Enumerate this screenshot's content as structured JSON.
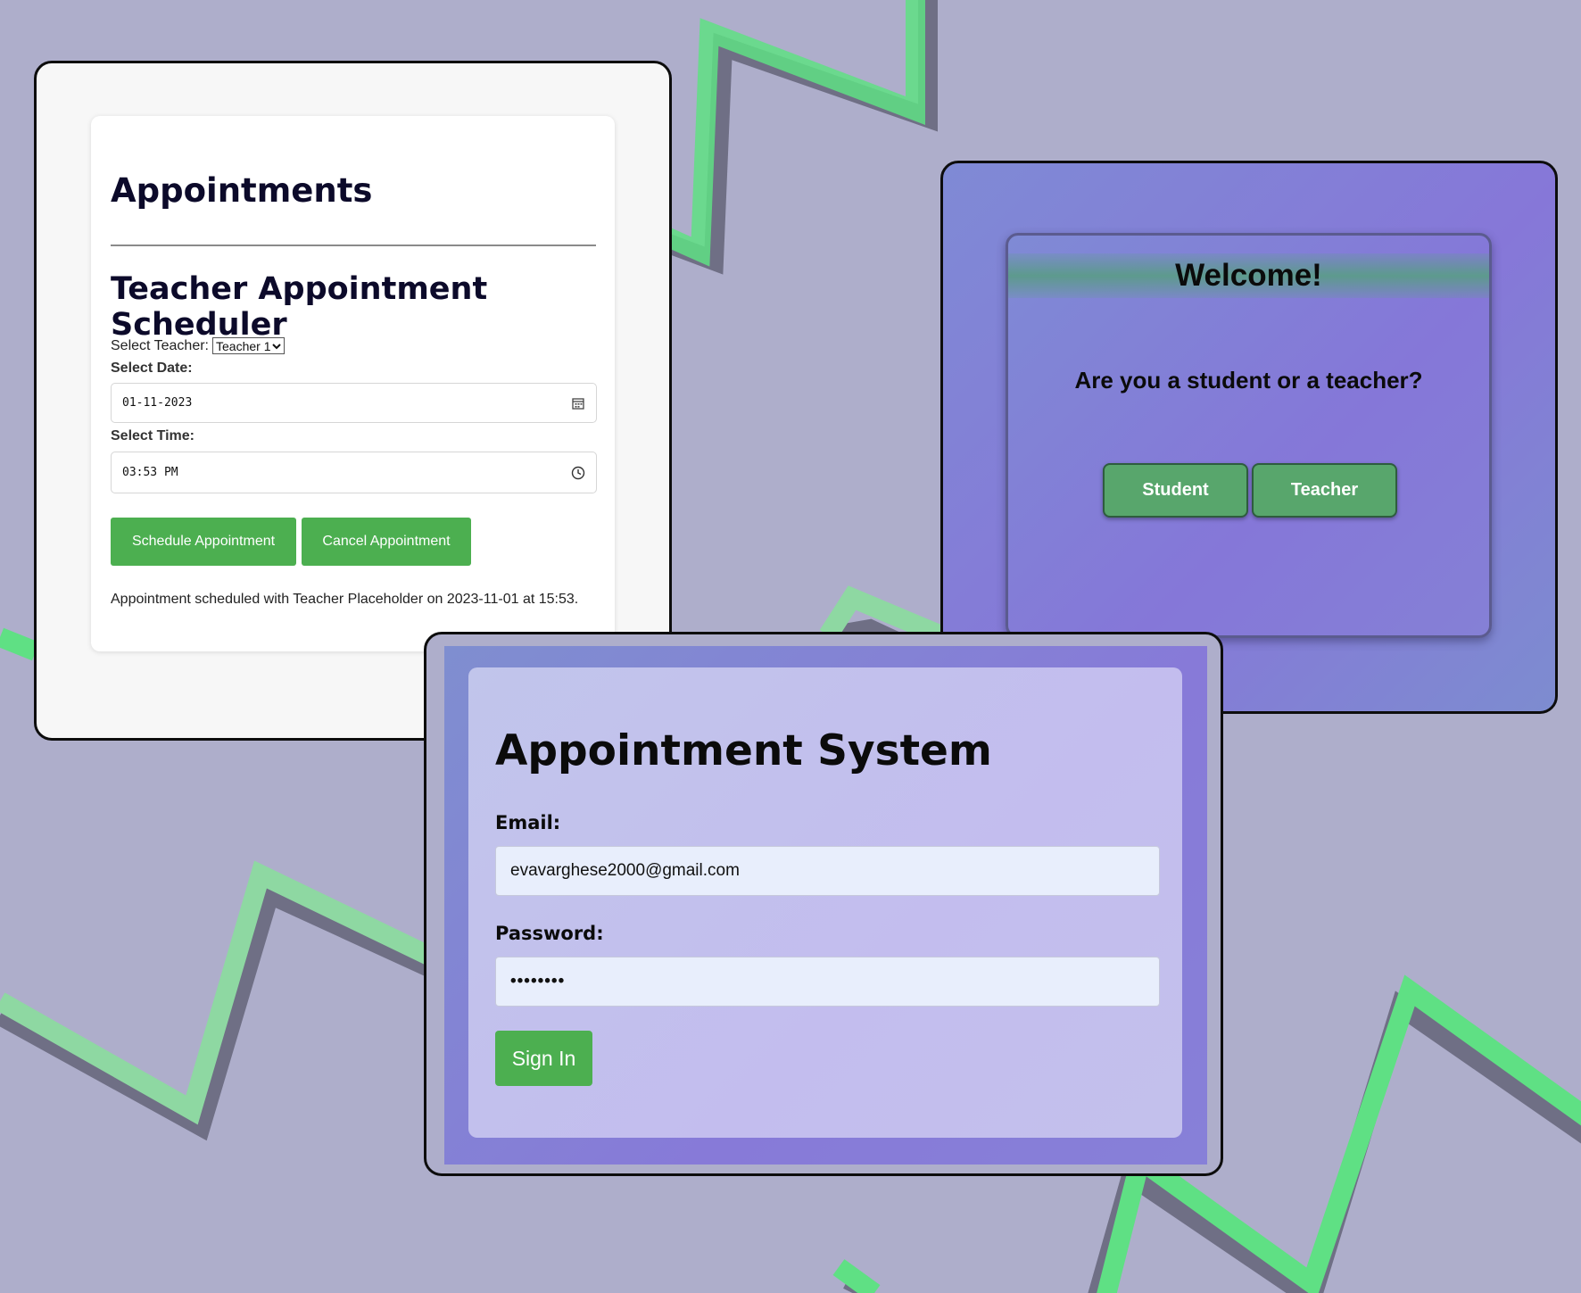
{
  "colors": {
    "background": "#aeaecb",
    "zigzag_green": "#5fe084",
    "zigzag_shadow": "#6f6f85",
    "button_green": "#4caf50",
    "role_button_green": "#58a66c",
    "frame_border": "#0d0d0d"
  },
  "appointments": {
    "heading": "Appointments",
    "scheduler_title": "Teacher Appointment Scheduler",
    "select_teacher_label": "Select Teacher:",
    "teacher_selected": "Teacher 1",
    "select_date_label": "Select Date:",
    "date_value": "01-11-2023",
    "select_time_label": "Select Time:",
    "time_value": "03:53 PM",
    "schedule_button": "Schedule Appointment",
    "cancel_button": "Cancel Appointment",
    "status_message": "Appointment scheduled with Teacher Placeholder on 2023-11-01 at 15:53.",
    "icons": {
      "date": "calendar-icon",
      "time": "clock-icon",
      "select": "chevron-down-icon"
    }
  },
  "welcome": {
    "title": "Welcome!",
    "question": "Are you a student or a teacher?",
    "student_button": "Student",
    "teacher_button": "Teacher"
  },
  "signin": {
    "title": "Appointment System",
    "email_label": "Email:",
    "email_value": "evavarghese2000@gmail.com",
    "password_label": "Password:",
    "password_value": "••••••••",
    "signin_button": "Sign In"
  }
}
